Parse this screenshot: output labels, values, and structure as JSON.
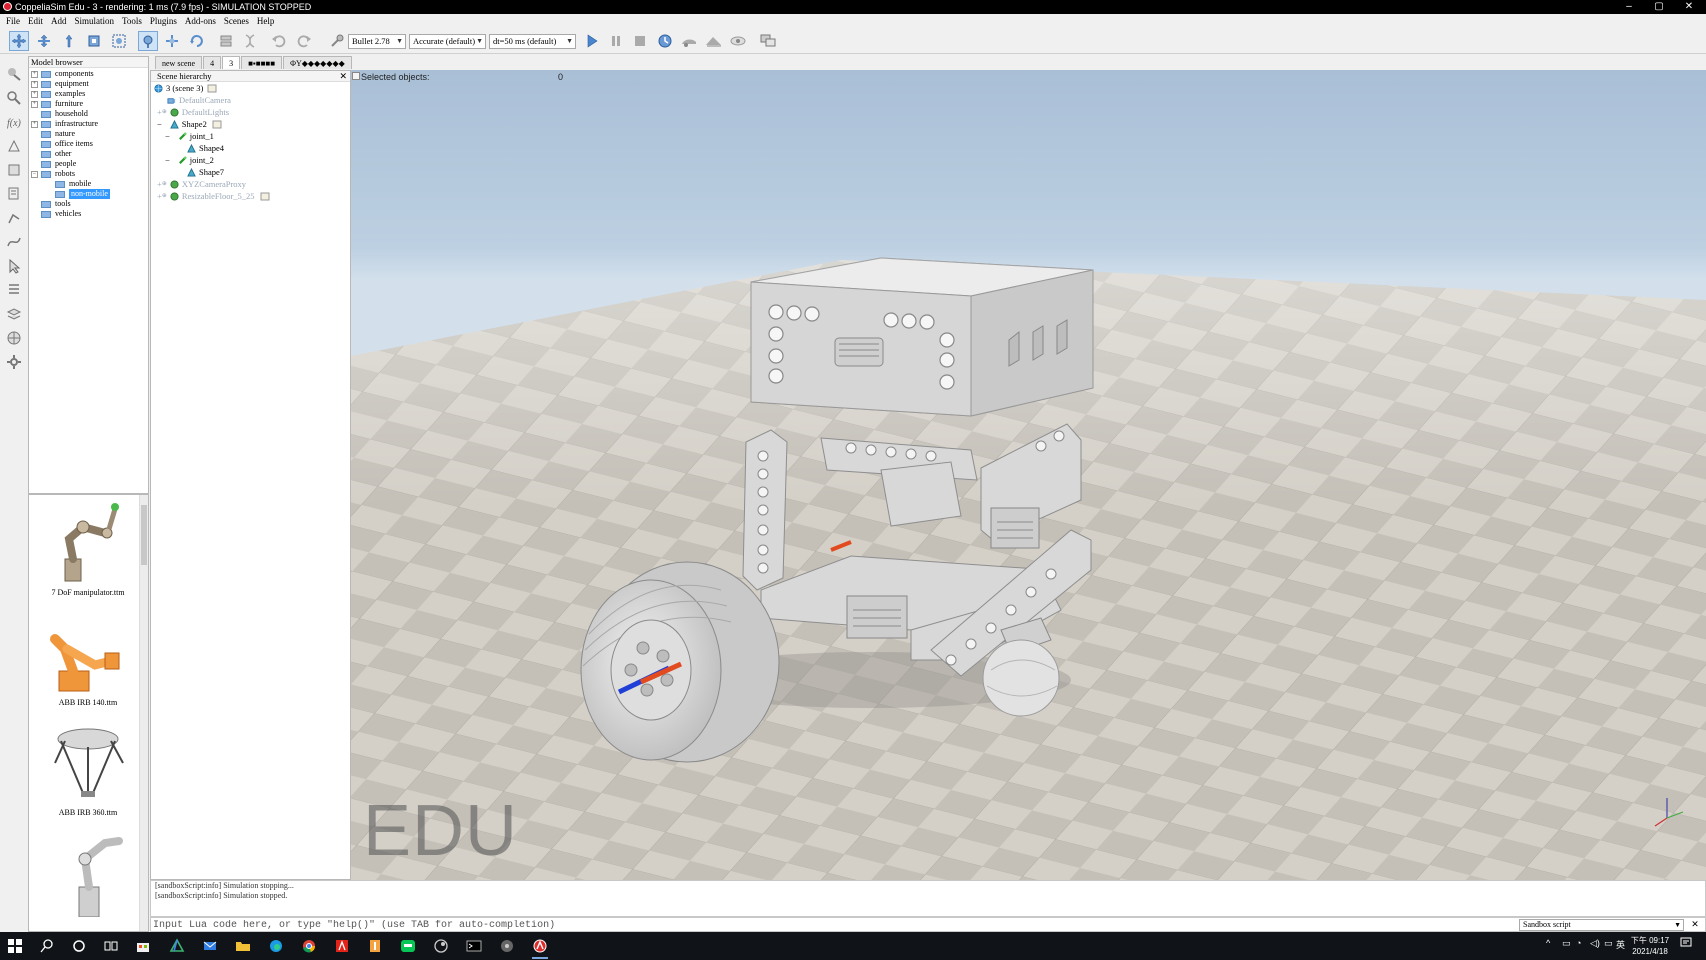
{
  "window": {
    "title": "CoppeliaSim Edu - 3 - rendering: 1 ms (7.9 fps) - SIMULATION STOPPED",
    "controls": {
      "minimize": "–",
      "maximize": "▢",
      "close": "✕"
    }
  },
  "menu": [
    "File",
    "Edit",
    "Add",
    "Simulation",
    "Tools",
    "Plugins",
    "Add-ons",
    "Scenes",
    "Help"
  ],
  "toolbar": {
    "engine": "Bullet 2.78",
    "accuracy": "Accurate (default)",
    "timestep": "dt=50 ms (default)",
    "icons": [
      "move-camera-icon",
      "pan-camera-icon",
      "rotate-camera-icon",
      "fit-view-icon",
      "zoom-icon",
      "object-select-icon",
      "object-shift-icon",
      "object-rotate-icon",
      "assemble-icon",
      "transfer-dna-icon",
      "undo-icon",
      "redo-icon",
      "dynamics-icon",
      "play-icon",
      "pause-icon",
      "stop-icon",
      "realtime-icon",
      "slow-down-icon",
      "speed-up-icon",
      "visualization-icon",
      "page-selector-icon"
    ]
  },
  "model_browser": {
    "title": "Model browser",
    "items": [
      {
        "label": "components",
        "exp": "+"
      },
      {
        "label": "equipment",
        "exp": "+"
      },
      {
        "label": "examples",
        "exp": "+"
      },
      {
        "label": "furniture",
        "exp": "+"
      },
      {
        "label": "household",
        "exp": ""
      },
      {
        "label": "infrastructure",
        "exp": "+"
      },
      {
        "label": "nature",
        "exp": ""
      },
      {
        "label": "office items",
        "exp": ""
      },
      {
        "label": "other",
        "exp": ""
      },
      {
        "label": "people",
        "exp": ""
      },
      {
        "label": "robots",
        "exp": "−"
      },
      {
        "label": "mobile",
        "exp": "",
        "indent": 1
      },
      {
        "label": "non-mobile",
        "exp": "",
        "indent": 1,
        "selected": true
      },
      {
        "label": "tools",
        "exp": ""
      },
      {
        "label": "vehicles",
        "exp": ""
      }
    ]
  },
  "thumbnails": [
    {
      "label": "7 DoF manipulator.ttm"
    },
    {
      "label": "ABB IRB 140.ttm"
    },
    {
      "label": "ABB IRB 360.ttm"
    },
    {
      "label": ""
    }
  ],
  "scene_tabs": [
    "new scene",
    "4",
    "3",
    "■▪■■■■",
    "ΦY◆◆◆◆◆◆◆"
  ],
  "scene_hierarchy": {
    "title": "Scene hierarchy",
    "close": "✕",
    "root": "3 (scene 3)",
    "items": [
      {
        "label": "DefaultCamera",
        "dim": true
      },
      {
        "label": "DefaultLights",
        "dim": true
      },
      {
        "label": "Shape2",
        "dim": false
      },
      {
        "label": "joint_1",
        "dim": false
      },
      {
        "label": "Shape4",
        "dim": false
      },
      {
        "label": "joint_2",
        "dim": false
      },
      {
        "label": "Shape7",
        "dim": false
      },
      {
        "label": "XYZCameraProxy",
        "dim": true
      },
      {
        "label": "ResizableFloor_5_25",
        "dim": true
      }
    ]
  },
  "viewport": {
    "selected_label": "Selected objects:",
    "selected_count": "0",
    "watermark": "EDU"
  },
  "console": {
    "lines": [
      "[sandboxScript:info] Simulation stopping...",
      "[sandboxScript:info] Simulation stopped."
    ],
    "input_placeholder": "Input Lua code here, or type \"help()\" (use TAB for auto-completion)",
    "script_select": "Sandbox script",
    "close": "✕"
  },
  "taskbar": {
    "tray_lang": "英",
    "clock_time": "下午 09:17",
    "clock_date": "2021/4/18"
  },
  "colors": {
    "selection": "#3399ff",
    "taskbar": "#101418",
    "sky_top": "#a9bfd6"
  }
}
